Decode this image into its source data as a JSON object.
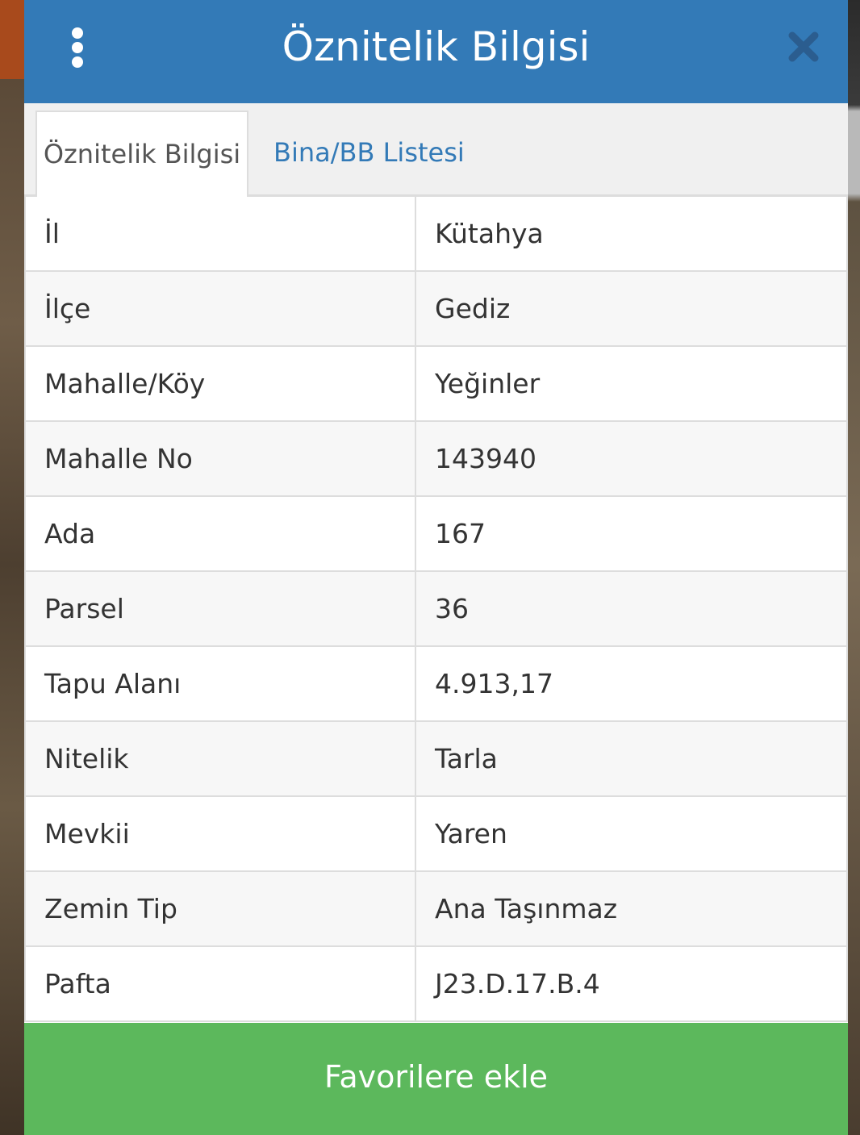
{
  "header": {
    "title": "Öznitelik Bilgisi",
    "menu_icon": "kebab-menu-icon",
    "close_icon": "close-icon"
  },
  "tabs": [
    {
      "label": "Öznitelik Bilgisi",
      "active": true
    },
    {
      "label": "Bina/BB Listesi",
      "active": false
    }
  ],
  "attributes": [
    {
      "key": "İl",
      "value": "Kütahya"
    },
    {
      "key": "İlçe",
      "value": "Gediz"
    },
    {
      "key": "Mahalle/Köy",
      "value": "Yeğinler"
    },
    {
      "key": "Mahalle No",
      "value": "143940"
    },
    {
      "key": "Ada",
      "value": "167"
    },
    {
      "key": "Parsel",
      "value": "36"
    },
    {
      "key": "Tapu Alanı",
      "value": "4.913,17"
    },
    {
      "key": "Nitelik",
      "value": "Tarla"
    },
    {
      "key": "Mevkii",
      "value": "Yaren"
    },
    {
      "key": "Zemin Tip",
      "value": "Ana Taşınmaz"
    },
    {
      "key": "Pafta",
      "value": "J23.D.17.B.4"
    }
  ],
  "footer": {
    "favorite_label": "Favorilere ekle"
  },
  "colors": {
    "header": "#337ab7",
    "tab_link": "#337ab7",
    "button": "#5cb85c"
  }
}
